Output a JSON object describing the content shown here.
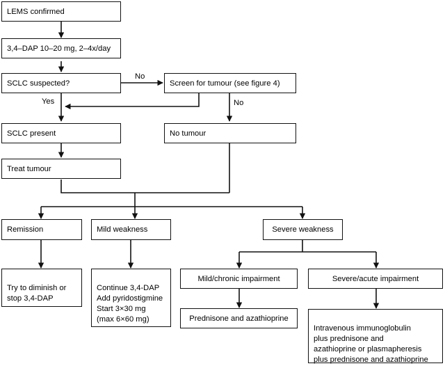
{
  "diagram": {
    "title": "LEMS treatment algorithm flowchart",
    "stroke_color": "#111111",
    "background_color": "#ffffff",
    "nodes": [
      {
        "id": "lems_confirmed",
        "label": "LEMS confirmed"
      },
      {
        "id": "dap_dose",
        "label": "3,4–DAP 10–20 mg, 2–4x/day"
      },
      {
        "id": "sclc_suspected",
        "label": "SCLC suspected?"
      },
      {
        "id": "screen_tumour",
        "label": "Screen for tumour (see figure 4)"
      },
      {
        "id": "sclc_present",
        "label": "SCLC present"
      },
      {
        "id": "no_tumour",
        "label": "No tumour"
      },
      {
        "id": "treat_tumour",
        "label": "Treat tumour"
      },
      {
        "id": "remission",
        "label": "Remission"
      },
      {
        "id": "mild_weakness",
        "label": "Mild weakness"
      },
      {
        "id": "severe_weakness",
        "label": "Severe weakness"
      },
      {
        "id": "try_diminish",
        "label": "Try to diminish or\nstop 3,4-DAP"
      },
      {
        "id": "continue_dap",
        "label": "Continue 3,4-DAP\nAdd pyridostigmine\nStart 3×30 mg\n(max 6×60 mg)"
      },
      {
        "id": "mild_chronic",
        "label": "Mild/chronic impairment"
      },
      {
        "id": "severe_acute",
        "label": "Severe/acute impairment"
      },
      {
        "id": "prednisone_aza",
        "label": "Prednisone and azathioprine"
      },
      {
        "id": "ivig_combo",
        "label": "Intravenous immunoglobulin\nplus prednisone and\nazathioprine or plasmapheresis\nplus prednisone and azathioprine"
      }
    ],
    "edge_labels": [
      {
        "id": "no_to_screen",
        "label": "No"
      },
      {
        "id": "yes_to_sclc",
        "label": "Yes"
      },
      {
        "id": "no_to_tumour",
        "label": "No"
      }
    ]
  }
}
